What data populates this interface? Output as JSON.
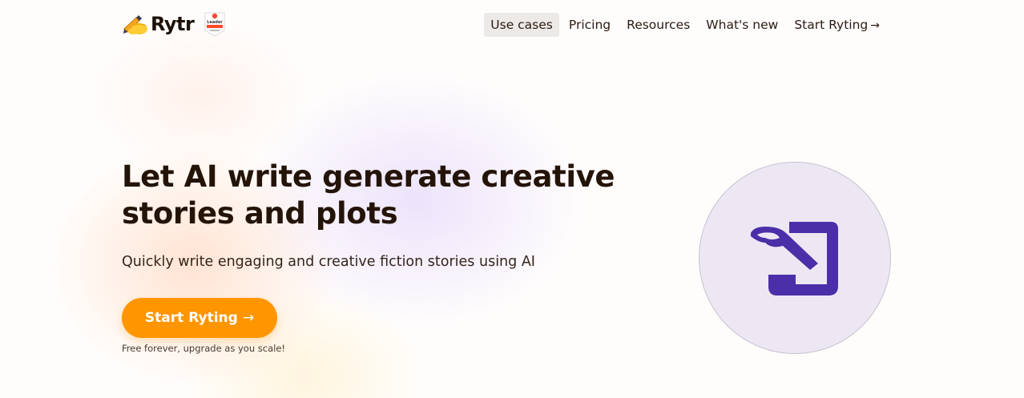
{
  "brand": {
    "name": "Rytr",
    "badge_text": "Leader"
  },
  "nav": {
    "items": [
      {
        "label": "Use cases",
        "active": true
      },
      {
        "label": "Pricing",
        "active": false
      },
      {
        "label": "Resources",
        "active": false
      },
      {
        "label": "What's new",
        "active": false
      }
    ],
    "cta_label": "Start Ryting",
    "cta_icon": "arrow-right-icon"
  },
  "hero": {
    "title": "Let AI write generate creative stories and plots",
    "subtitle": "Quickly write engaging and creative fiction stories using AI",
    "cta_label": "Start Ryting",
    "cta_note": "Free forever, upgrade as you scale!",
    "illustration_icon": "quill-scroll-icon"
  },
  "colors": {
    "accent": "#ff9600",
    "illustration_bg": "#ede7f4",
    "illustration_icon": "#4a2fa8",
    "nav_active_bg": "#ece9e6"
  }
}
